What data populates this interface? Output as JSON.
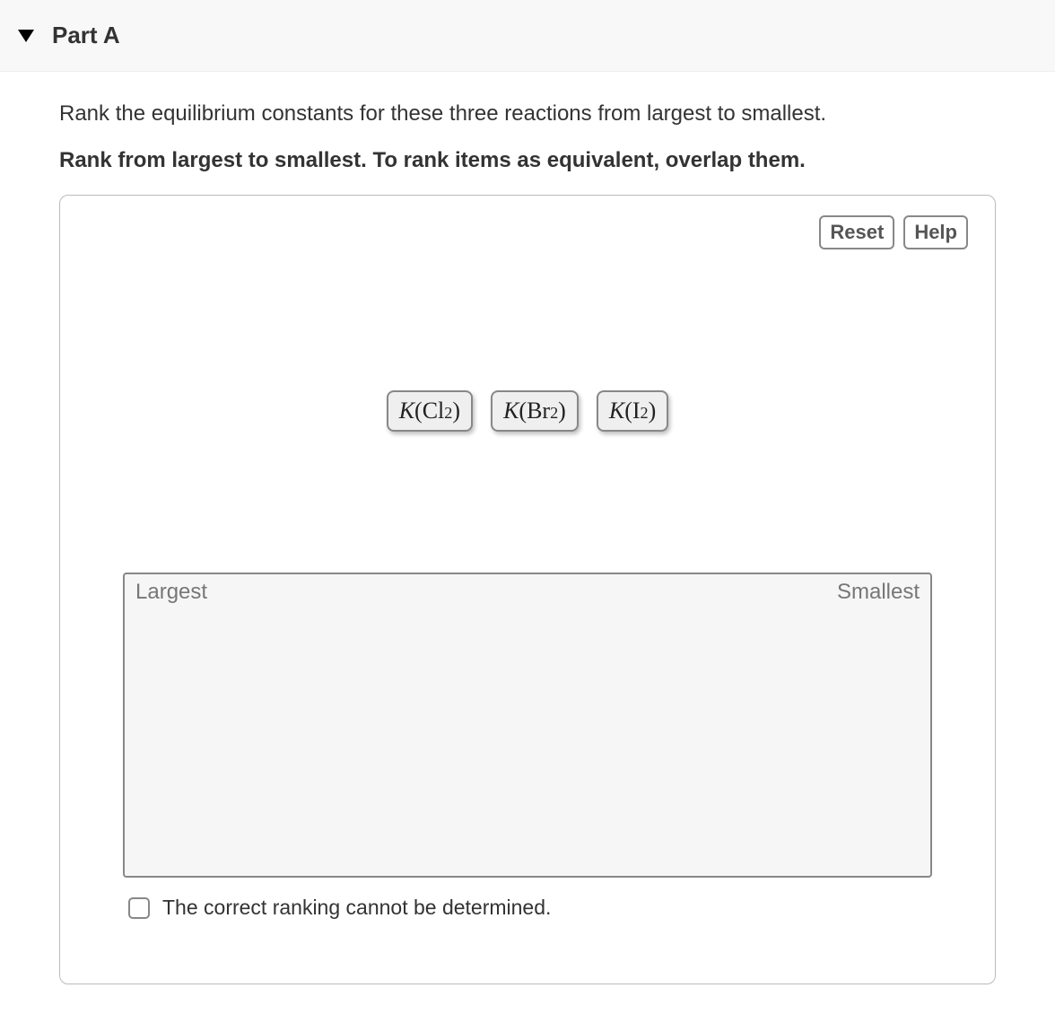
{
  "header": {
    "part_label": "Part A"
  },
  "instructions": {
    "line1": "Rank the equilibrium constants for these three reactions from largest to smallest.",
    "line2": "Rank from largest to smallest.  To rank items as equivalent, overlap them."
  },
  "controls": {
    "reset_label": "Reset",
    "help_label": "Help"
  },
  "items": [
    {
      "k": "K",
      "open": "(",
      "elem": "Cl",
      "sub": "2",
      "close": ")"
    },
    {
      "k": "K",
      "open": "(",
      "elem": "Br",
      "sub": "2",
      "close": ")"
    },
    {
      "k": "K",
      "open": "(",
      "elem": "I",
      "sub": "2",
      "close": ")"
    }
  ],
  "dropzone": {
    "left_label": "Largest",
    "right_label": "Smallest"
  },
  "checkbox": {
    "label": "The correct ranking cannot be determined."
  }
}
